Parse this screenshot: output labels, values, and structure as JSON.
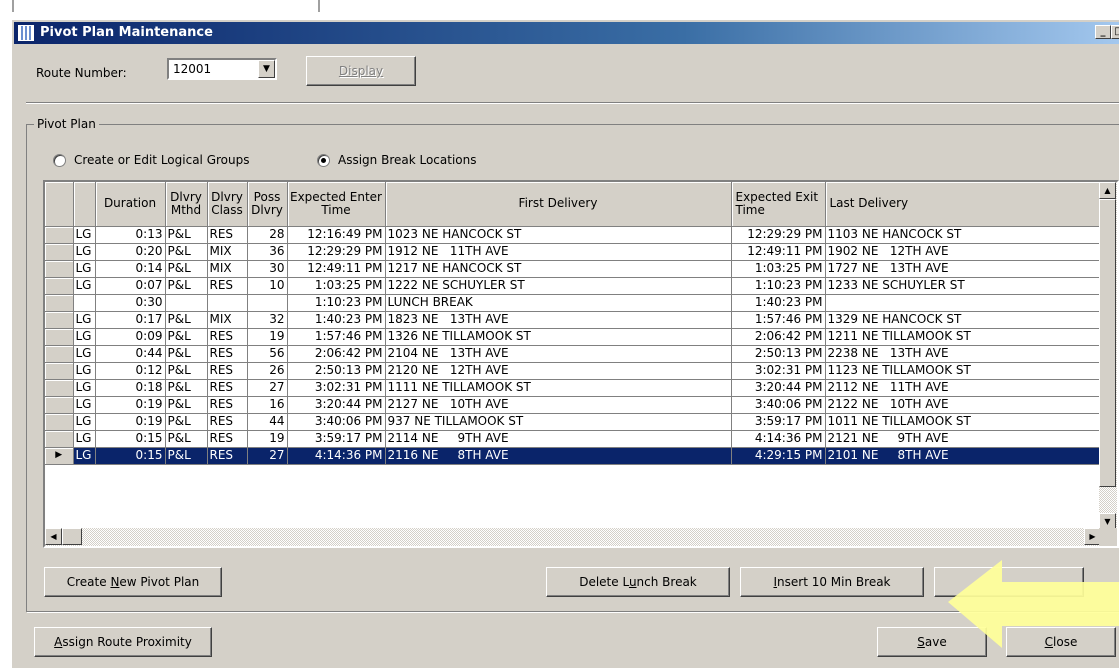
{
  "window": {
    "title": "Pivot Plan Maintenance"
  },
  "route": {
    "label": "Route Number:",
    "value": "12001",
    "display_button": "Display"
  },
  "pivot_plan": {
    "group_label": "Pivot Plan",
    "radio_logical_groups": "Create or Edit Logical Groups",
    "radio_break_locations": "Assign Break Locations",
    "selected_mode": "break_locations"
  },
  "grid": {
    "columns": {
      "duration": "Duration",
      "dlvry_mthd": "Dlvry Mthd",
      "dlvry_class": "Dlvry Class",
      "poss_dlvry": "Poss Dlvry",
      "expected_enter": "Expected Enter Time",
      "first_delivery": "First Delivery",
      "expected_exit": "Expected Exit Time",
      "last_delivery": "Last Delivery"
    },
    "rows": [
      {
        "type": "LG",
        "duration": "0:13",
        "mthd": "P&L",
        "cls": "RES",
        "poss": "28",
        "enter": "12:16:49 PM",
        "first": "1023 NE HANCOCK ST",
        "exit": "12:29:29 PM",
        "last": "1103 NE HANCOCK ST"
      },
      {
        "type": "LG",
        "duration": "0:20",
        "mthd": "P&L",
        "cls": "MIX",
        "poss": "36",
        "enter": "12:29:29 PM",
        "first": "1912 NE   11TH AVE",
        "exit": "12:49:11 PM",
        "last": "1902 NE   12TH AVE"
      },
      {
        "type": "LG",
        "duration": "0:14",
        "mthd": "P&L",
        "cls": "MIX",
        "poss": "30",
        "enter": "12:49:11 PM",
        "first": "1217 NE HANCOCK ST",
        "exit": "1:03:25 PM",
        "last": "1727 NE   13TH AVE"
      },
      {
        "type": "LG",
        "duration": "0:07",
        "mthd": "P&L",
        "cls": "RES",
        "poss": "10",
        "enter": "1:03:25 PM",
        "first": "1222 NE SCHUYLER ST",
        "exit": "1:10:23 PM",
        "last": "1233 NE SCHUYLER ST"
      },
      {
        "type": "",
        "duration": "0:30",
        "mthd": "",
        "cls": "",
        "poss": "",
        "enter": "1:10:23 PM",
        "first": "LUNCH BREAK",
        "exit": "1:40:23 PM",
        "last": ""
      },
      {
        "type": "LG",
        "duration": "0:17",
        "mthd": "P&L",
        "cls": "MIX",
        "poss": "32",
        "enter": "1:40:23 PM",
        "first": "1823 NE   13TH AVE",
        "exit": "1:57:46 PM",
        "last": "1329 NE HANCOCK ST"
      },
      {
        "type": "LG",
        "duration": "0:09",
        "mthd": "P&L",
        "cls": "RES",
        "poss": "19",
        "enter": "1:57:46 PM",
        "first": "1326 NE TILLAMOOK ST",
        "exit": "2:06:42 PM",
        "last": "1211 NE TILLAMOOK ST"
      },
      {
        "type": "LG",
        "duration": "0:44",
        "mthd": "P&L",
        "cls": "RES",
        "poss": "56",
        "enter": "2:06:42 PM",
        "first": "2104 NE   13TH AVE",
        "exit": "2:50:13 PM",
        "last": "2238 NE   13TH AVE"
      },
      {
        "type": "LG",
        "duration": "0:12",
        "mthd": "P&L",
        "cls": "RES",
        "poss": "26",
        "enter": "2:50:13 PM",
        "first": "2120 NE   12TH AVE",
        "exit": "3:02:31 PM",
        "last": "1123 NE TILLAMOOK ST"
      },
      {
        "type": "LG",
        "duration": "0:18",
        "mthd": "P&L",
        "cls": "RES",
        "poss": "27",
        "enter": "3:02:31 PM",
        "first": "1111 NE TILLAMOOK ST",
        "exit": "3:20:44 PM",
        "last": "2112 NE   11TH AVE"
      },
      {
        "type": "LG",
        "duration": "0:19",
        "mthd": "P&L",
        "cls": "RES",
        "poss": "16",
        "enter": "3:20:44 PM",
        "first": "2127 NE   10TH AVE",
        "exit": "3:40:06 PM",
        "last": "2122 NE   10TH AVE"
      },
      {
        "type": "LG",
        "duration": "0:19",
        "mthd": "P&L",
        "cls": "RES",
        "poss": "44",
        "enter": "3:40:06 PM",
        "first": "937 NE TILLAMOOK ST",
        "exit": "3:59:17 PM",
        "last": "1011 NE TILLAMOOK ST"
      },
      {
        "type": "LG",
        "duration": "0:15",
        "mthd": "P&L",
        "cls": "RES",
        "poss": "19",
        "enter": "3:59:17 PM",
        "first": "2114 NE     9TH AVE",
        "exit": "4:14:36 PM",
        "last": "2121 NE     9TH AVE"
      },
      {
        "type": "LG",
        "duration": "0:15",
        "mthd": "P&L",
        "cls": "RES",
        "poss": "27",
        "enter": "4:14:36 PM",
        "first": "2116 NE     8TH AVE",
        "exit": "4:29:15 PM",
        "last": "2101 NE     8TH AVE",
        "selected": true
      }
    ]
  },
  "buttons": {
    "create_new_pivot_plan": {
      "before": "Create ",
      "key": "N",
      "after": "ew Pivot Plan"
    },
    "delete_lunch_break": {
      "before": "Delete L",
      "key": "u",
      "after": "nch Break"
    },
    "insert_10_min_break": {
      "before": "",
      "key": "I",
      "after": "nsert 10 Min Break"
    },
    "assign_route_proximity": {
      "before": "",
      "key": "A",
      "after": "ssign Route Proximity"
    },
    "save": {
      "before": "",
      "key": "S",
      "after": "ave"
    },
    "close": {
      "before": "",
      "key": "C",
      "after": "lose"
    }
  },
  "colors": {
    "selection": "#0a246a",
    "annotation_arrow": "#ffff99",
    "window_face": "#d4d0c8"
  },
  "icons": {
    "app": "app-grid-icon",
    "row_pointer": "row-pointer-icon",
    "arrow_annotation": "yellow-arrow-annotation"
  }
}
